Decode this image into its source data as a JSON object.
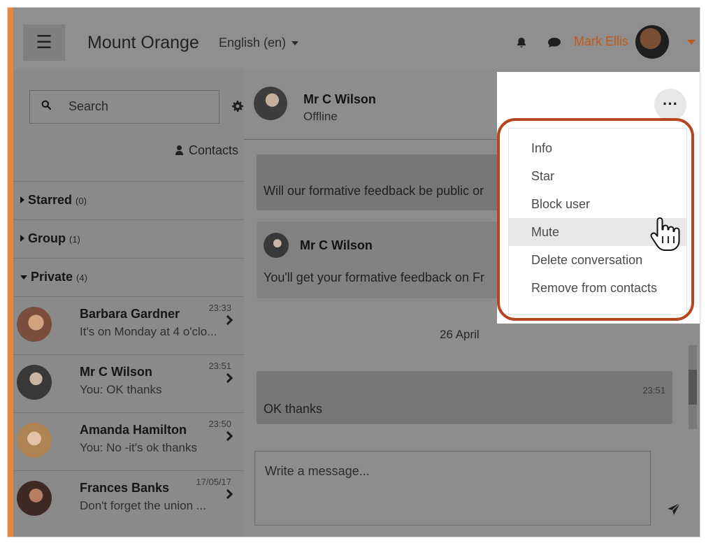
{
  "topbar": {
    "site_name": "Mount Orange",
    "language": "English (en)",
    "user_name": "Mark Ellis"
  },
  "sidebar": {
    "search_placeholder": "Search",
    "contacts_label": "Contacts",
    "sections": [
      {
        "title": "Starred",
        "count": "(0)"
      },
      {
        "title": "Group",
        "count": "(1)"
      },
      {
        "title": "Private",
        "count": "(4)"
      }
    ],
    "contacts": [
      {
        "name": "Barbara Gardner",
        "time": "23:33",
        "preview": "It's on Monday at 4 o'clo..."
      },
      {
        "name": "Mr C Wilson",
        "time": "23:51",
        "preview": "You: OK thanks"
      },
      {
        "name": "Amanda Hamilton",
        "time": "23:50",
        "preview": "You: No -it's ok thanks"
      },
      {
        "name": "Frances Banks",
        "time": "17/05/17",
        "preview": "Don't forget the union ..."
      }
    ]
  },
  "conversation": {
    "contact_name": "Mr C Wilson",
    "status": "Offline",
    "messages": [
      {
        "text": "Will our formative feedback be public or"
      },
      {
        "sender": "Mr C Wilson",
        "text": "You'll get your formative feedback on Fr"
      },
      {
        "date": "26 April"
      },
      {
        "time": "23:51",
        "text": "OK thanks"
      }
    ],
    "composer_placeholder": "Write a message..."
  },
  "menu": {
    "items": [
      {
        "label": "Info"
      },
      {
        "label": "Star"
      },
      {
        "label": "Block user"
      },
      {
        "label": "Mute"
      },
      {
        "label": "Delete conversation"
      },
      {
        "label": "Remove from contacts"
      }
    ],
    "active_item": "Mute"
  },
  "colors": {
    "accent": "#c2581a",
    "highlight_ring": "#b5461f",
    "left_accent": "#e9863a"
  },
  "icons": [
    "menu-icon",
    "bell-icon",
    "chat-icon",
    "search-icon",
    "gear-icon",
    "send-icon",
    "more-options-icon",
    "cursor-hand-icon"
  ]
}
